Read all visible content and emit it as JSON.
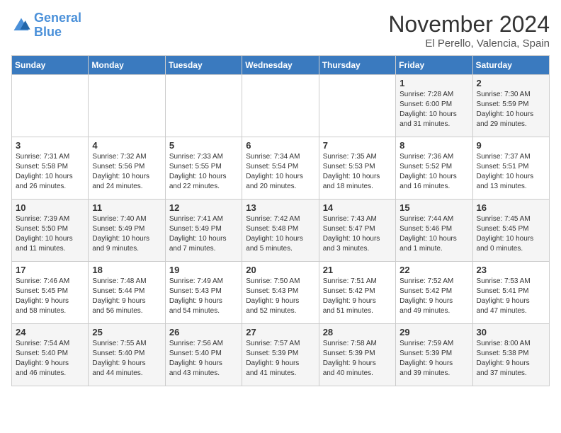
{
  "logo": {
    "line1": "General",
    "line2": "Blue"
  },
  "header": {
    "month": "November 2024",
    "location": "El Perello, Valencia, Spain"
  },
  "weekdays": [
    "Sunday",
    "Monday",
    "Tuesday",
    "Wednesday",
    "Thursday",
    "Friday",
    "Saturday"
  ],
  "weeks": [
    [
      {
        "day": "",
        "info": ""
      },
      {
        "day": "",
        "info": ""
      },
      {
        "day": "",
        "info": ""
      },
      {
        "day": "",
        "info": ""
      },
      {
        "day": "",
        "info": ""
      },
      {
        "day": "1",
        "info": "Sunrise: 7:28 AM\nSunset: 6:00 PM\nDaylight: 10 hours\nand 31 minutes."
      },
      {
        "day": "2",
        "info": "Sunrise: 7:30 AM\nSunset: 5:59 PM\nDaylight: 10 hours\nand 29 minutes."
      }
    ],
    [
      {
        "day": "3",
        "info": "Sunrise: 7:31 AM\nSunset: 5:58 PM\nDaylight: 10 hours\nand 26 minutes."
      },
      {
        "day": "4",
        "info": "Sunrise: 7:32 AM\nSunset: 5:56 PM\nDaylight: 10 hours\nand 24 minutes."
      },
      {
        "day": "5",
        "info": "Sunrise: 7:33 AM\nSunset: 5:55 PM\nDaylight: 10 hours\nand 22 minutes."
      },
      {
        "day": "6",
        "info": "Sunrise: 7:34 AM\nSunset: 5:54 PM\nDaylight: 10 hours\nand 20 minutes."
      },
      {
        "day": "7",
        "info": "Sunrise: 7:35 AM\nSunset: 5:53 PM\nDaylight: 10 hours\nand 18 minutes."
      },
      {
        "day": "8",
        "info": "Sunrise: 7:36 AM\nSunset: 5:52 PM\nDaylight: 10 hours\nand 16 minutes."
      },
      {
        "day": "9",
        "info": "Sunrise: 7:37 AM\nSunset: 5:51 PM\nDaylight: 10 hours\nand 13 minutes."
      }
    ],
    [
      {
        "day": "10",
        "info": "Sunrise: 7:39 AM\nSunset: 5:50 PM\nDaylight: 10 hours\nand 11 minutes."
      },
      {
        "day": "11",
        "info": "Sunrise: 7:40 AM\nSunset: 5:49 PM\nDaylight: 10 hours\nand 9 minutes."
      },
      {
        "day": "12",
        "info": "Sunrise: 7:41 AM\nSunset: 5:49 PM\nDaylight: 10 hours\nand 7 minutes."
      },
      {
        "day": "13",
        "info": "Sunrise: 7:42 AM\nSunset: 5:48 PM\nDaylight: 10 hours\nand 5 minutes."
      },
      {
        "day": "14",
        "info": "Sunrise: 7:43 AM\nSunset: 5:47 PM\nDaylight: 10 hours\nand 3 minutes."
      },
      {
        "day": "15",
        "info": "Sunrise: 7:44 AM\nSunset: 5:46 PM\nDaylight: 10 hours\nand 1 minute."
      },
      {
        "day": "16",
        "info": "Sunrise: 7:45 AM\nSunset: 5:45 PM\nDaylight: 10 hours\nand 0 minutes."
      }
    ],
    [
      {
        "day": "17",
        "info": "Sunrise: 7:46 AM\nSunset: 5:45 PM\nDaylight: 9 hours\nand 58 minutes."
      },
      {
        "day": "18",
        "info": "Sunrise: 7:48 AM\nSunset: 5:44 PM\nDaylight: 9 hours\nand 56 minutes."
      },
      {
        "day": "19",
        "info": "Sunrise: 7:49 AM\nSunset: 5:43 PM\nDaylight: 9 hours\nand 54 minutes."
      },
      {
        "day": "20",
        "info": "Sunrise: 7:50 AM\nSunset: 5:43 PM\nDaylight: 9 hours\nand 52 minutes."
      },
      {
        "day": "21",
        "info": "Sunrise: 7:51 AM\nSunset: 5:42 PM\nDaylight: 9 hours\nand 51 minutes."
      },
      {
        "day": "22",
        "info": "Sunrise: 7:52 AM\nSunset: 5:42 PM\nDaylight: 9 hours\nand 49 minutes."
      },
      {
        "day": "23",
        "info": "Sunrise: 7:53 AM\nSunset: 5:41 PM\nDaylight: 9 hours\nand 47 minutes."
      }
    ],
    [
      {
        "day": "24",
        "info": "Sunrise: 7:54 AM\nSunset: 5:40 PM\nDaylight: 9 hours\nand 46 minutes."
      },
      {
        "day": "25",
        "info": "Sunrise: 7:55 AM\nSunset: 5:40 PM\nDaylight: 9 hours\nand 44 minutes."
      },
      {
        "day": "26",
        "info": "Sunrise: 7:56 AM\nSunset: 5:40 PM\nDaylight: 9 hours\nand 43 minutes."
      },
      {
        "day": "27",
        "info": "Sunrise: 7:57 AM\nSunset: 5:39 PM\nDaylight: 9 hours\nand 41 minutes."
      },
      {
        "day": "28",
        "info": "Sunrise: 7:58 AM\nSunset: 5:39 PM\nDaylight: 9 hours\nand 40 minutes."
      },
      {
        "day": "29",
        "info": "Sunrise: 7:59 AM\nSunset: 5:39 PM\nDaylight: 9 hours\nand 39 minutes."
      },
      {
        "day": "30",
        "info": "Sunrise: 8:00 AM\nSunset: 5:38 PM\nDaylight: 9 hours\nand 37 minutes."
      }
    ]
  ]
}
